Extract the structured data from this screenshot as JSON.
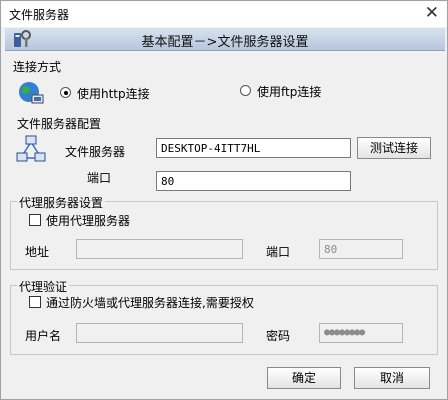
{
  "window": {
    "title": "文件服务器",
    "close_glyph": "✕"
  },
  "header": {
    "title": "基本配置－>文件服务器设置"
  },
  "connection": {
    "section_label": "连接方式",
    "http_label": "使用http连接",
    "ftp_label": "使用ftp连接",
    "selected": "http"
  },
  "file_server": {
    "section_label": "文件服务器配置",
    "server_label": "文件服务器",
    "server_value": "DESKTOP-4ITT7HL",
    "test_button": "测试连接",
    "port_label": "端口",
    "port_value": "80"
  },
  "proxy": {
    "group_title": "代理服务器设置",
    "use_proxy_label": "使用代理服务器",
    "address_label": "地址",
    "address_value": "",
    "port_label": "端口",
    "port_value": "80"
  },
  "auth": {
    "group_title": "代理验证",
    "need_auth_label": "通过防火墙或代理服务器连接,需要授权",
    "username_label": "用户名",
    "username_value": "",
    "password_label": "密码",
    "password_value": "●●●●●●●●"
  },
  "footer": {
    "ok_button": "确定",
    "cancel_button": "取消"
  }
}
